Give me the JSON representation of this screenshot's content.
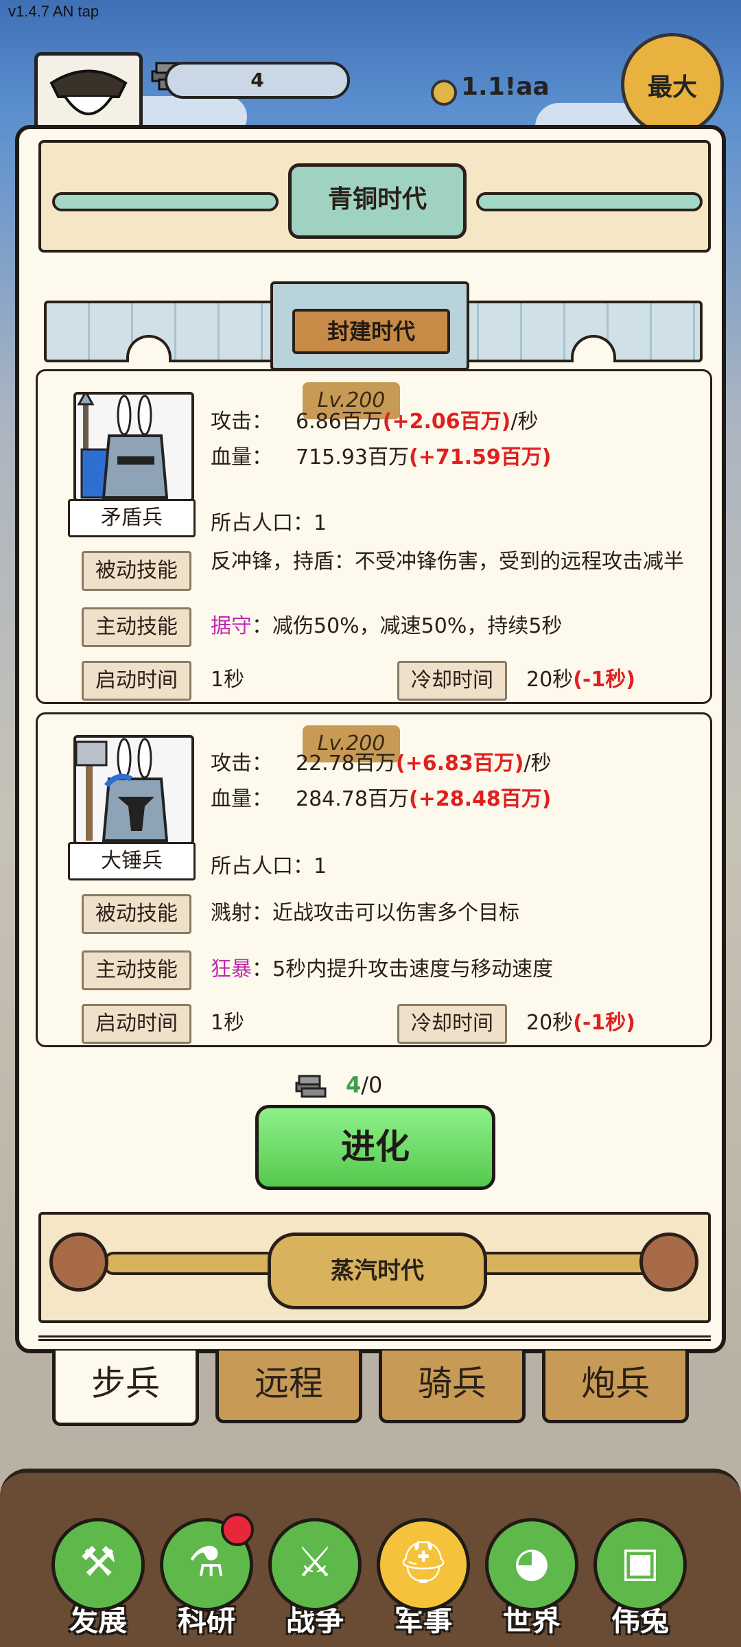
{
  "version": "v1.4.7 AN tap",
  "topbar": {
    "resource_count": "4",
    "coins": "1.1!aa",
    "max_label": "最大"
  },
  "era": {
    "current": "青铜时代",
    "section": "封建时代",
    "next": "蒸汽时代"
  },
  "units": [
    {
      "name": "矛盾兵",
      "level": "Lv.200",
      "attack_label": "攻击：",
      "attack_value": "6.86百万",
      "attack_bonus": "(+2.06百万)",
      "attack_suffix": "/秒",
      "hp_label": "血量：",
      "hp_value": "715.93百万",
      "hp_bonus": "(+71.59百万)",
      "population": "所占人口：1",
      "passive_label": "被动技能",
      "passive_text": "反冲锋，持盾：不受冲锋伤害，受到的远程攻击减半",
      "active_label": "主动技能",
      "active_name": "据守",
      "active_text": "：减伤50%，减速50%，持续5秒",
      "startup_label": "启动时间",
      "startup_value": "1秒",
      "cooldown_label": "冷却时间",
      "cooldown_value": "20秒",
      "cooldown_bonus": "(-1秒)"
    },
    {
      "name": "大锤兵",
      "level": "Lv.200",
      "attack_label": "攻击：",
      "attack_value": "22.78百万",
      "attack_bonus": "(+6.83百万)",
      "attack_suffix": "/秒",
      "hp_label": "血量：",
      "hp_value": "284.78百万",
      "hp_bonus": "(+28.48百万)",
      "population": "所占人口：1",
      "passive_label": "被动技能",
      "passive_text": "溅射：近战攻击可以伤害多个目标",
      "active_label": "主动技能",
      "active_name": "狂暴",
      "active_text": "：5秒内提升攻击速度与移动速度",
      "startup_label": "启动时间",
      "startup_value": "1秒",
      "cooldown_label": "冷却时间",
      "cooldown_value": "20秒",
      "cooldown_bonus": "(-1秒)"
    }
  ],
  "evolve": {
    "cost_have": "4",
    "cost_need": "/0",
    "button_label": "进化"
  },
  "tabs": [
    {
      "label": "步兵",
      "active": true
    },
    {
      "label": "远程",
      "active": false
    },
    {
      "label": "骑兵",
      "active": false
    },
    {
      "label": "炮兵",
      "active": false
    }
  ],
  "nav": [
    {
      "label": "发展",
      "icon": "hammer-icon"
    },
    {
      "label": "科研",
      "icon": "flask-icon",
      "badge": true
    },
    {
      "label": "战争",
      "icon": "crossed-swords-icon"
    },
    {
      "label": "军事",
      "icon": "helmet-icon",
      "active": true
    },
    {
      "label": "世界",
      "icon": "globe-icon"
    },
    {
      "label": "伟兔",
      "icon": "rabbit-card-icon"
    }
  ]
}
